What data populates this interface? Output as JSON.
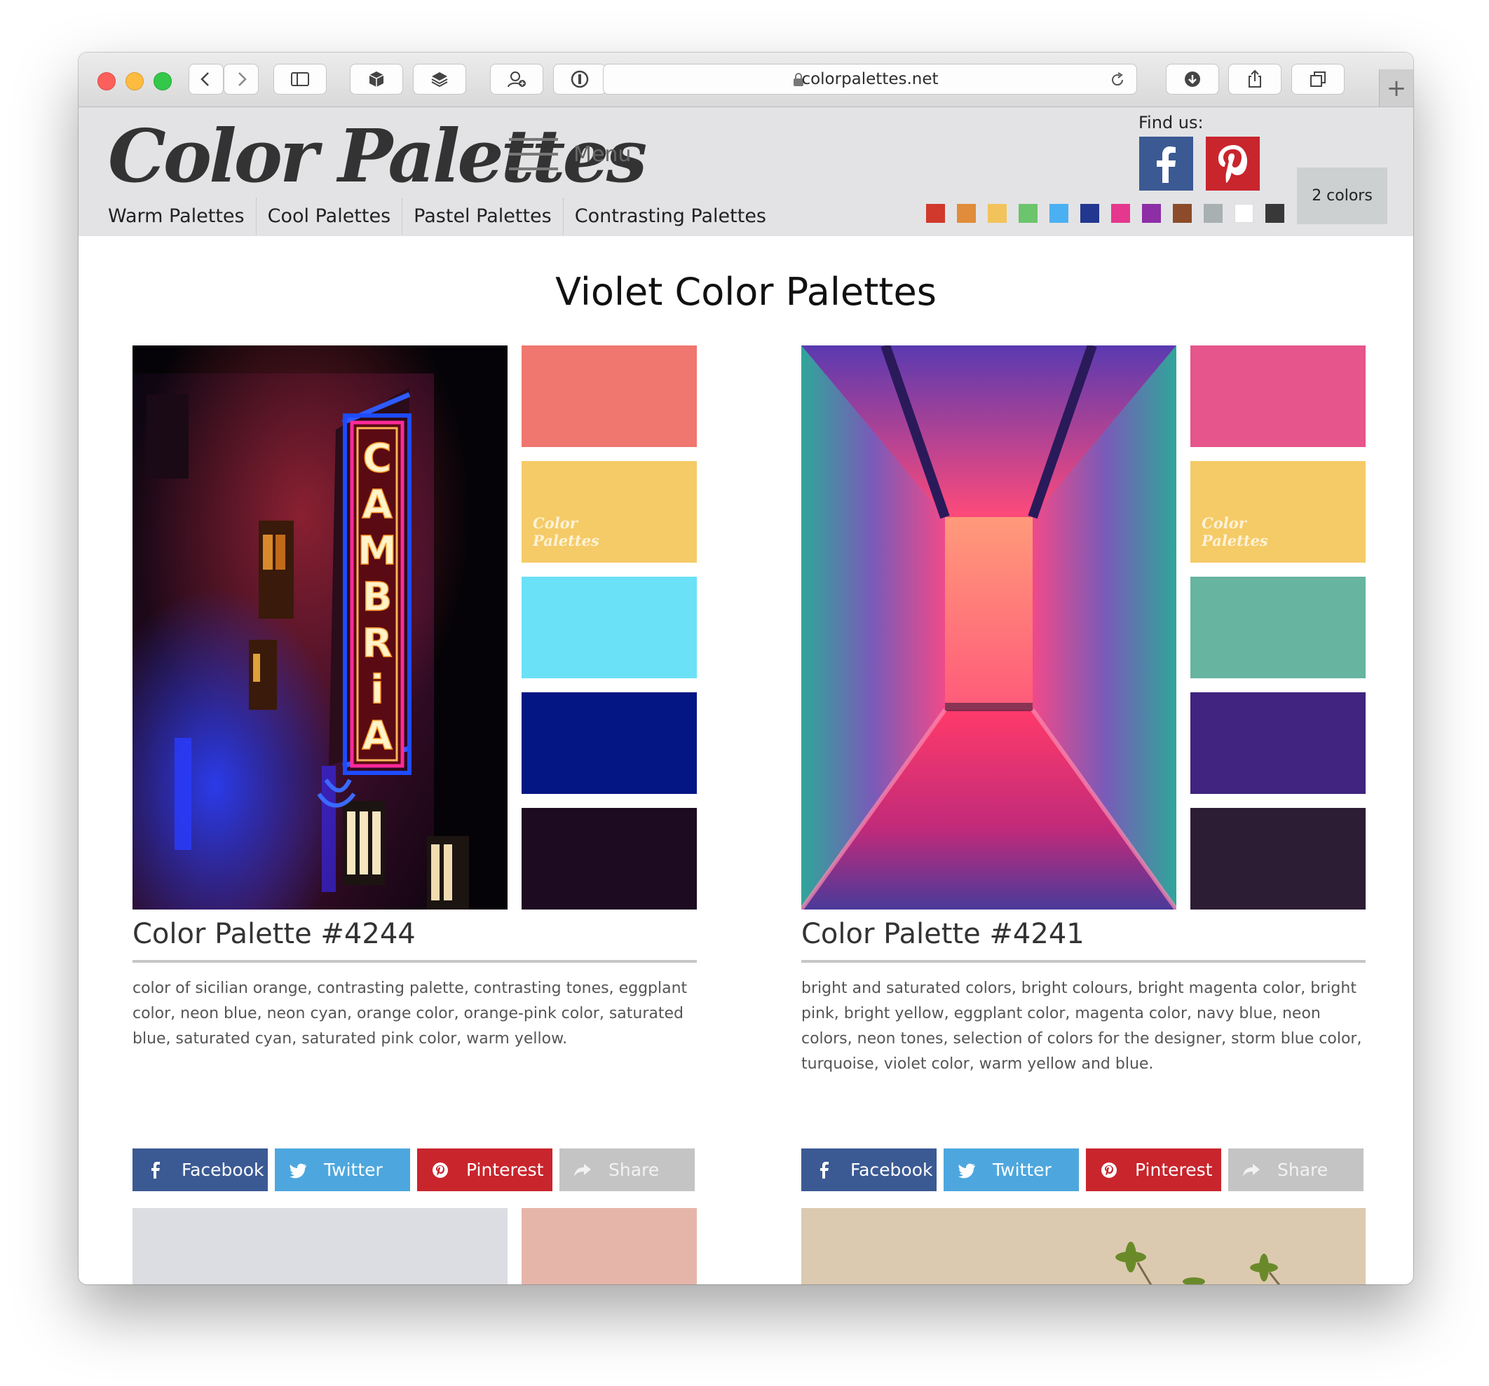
{
  "browser": {
    "url": "colorpalettes.net",
    "new_tab": "+"
  },
  "header": {
    "logo": "Color Palettes",
    "menu_label": "Menu",
    "find_us": "Find us:",
    "nav": [
      "Warm Palettes",
      "Cool Palettes",
      "Pastel Palettes",
      "Contrasting Palettes"
    ],
    "swatch_colors": [
      "#d0392b",
      "#e08c3a",
      "#f2c35a",
      "#6cc46c",
      "#4bb0f2",
      "#22378f",
      "#e4378d",
      "#8d2ea6",
      "#8c4b2a",
      "#a8b0b1",
      "#ffffff",
      "#383838"
    ],
    "colors_button": "2 colors"
  },
  "main": {
    "title": "Violet Color Palettes",
    "watermark_line1": "Color",
    "watermark_line2": "Palettes",
    "share_labels": {
      "facebook": "Facebook",
      "twitter": "Twitter",
      "pinterest": "Pinterest",
      "share": "Share"
    },
    "palettes": [
      {
        "title": "Color Palette #4244",
        "image": "neon CAMBRIA theatre sign at night",
        "sign_letters": [
          "C",
          "A",
          "M",
          "B",
          "R",
          "i",
          "A"
        ],
        "colors": [
          "#ef776f",
          "#f5cb67",
          "#6ae1f7",
          "#031683",
          "#1d0b22"
        ],
        "description": "color of sicilian orange, contrasting palette, contrasting tones, eggplant color, neon blue, neon cyan, orange color, orange-pink color, saturated blue, saturated cyan, saturated pink color, warm yellow."
      },
      {
        "title": "Color Palette #4241",
        "image": "neon pink and turquoise corridor",
        "colors": [
          "#e6558b",
          "#f5cb67",
          "#67b4a0",
          "#40247f",
          "#2d1d34"
        ],
        "description": "bright and saturated colors, bright colours, bright magenta color, bright pink, bright yellow, eggplant color, magenta color, navy blue, neon colors, neon tones, selection of colors for the designer, storm blue color, turquoise, violet color, warm yellow and blue."
      }
    ],
    "next_row": [
      {
        "top_color": "#e6b5aa"
      },
      {
        "top_color": "#e0cdb3"
      }
    ]
  }
}
